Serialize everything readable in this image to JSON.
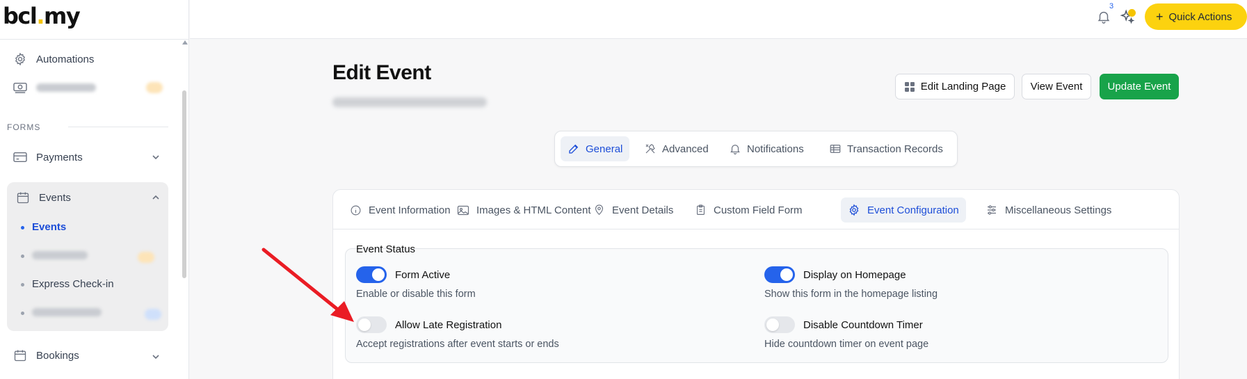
{
  "brand": {
    "logo_pre": "bcl",
    "logo_dot": ".",
    "logo_post": "my"
  },
  "sidebar": {
    "section_forms": "FORMS",
    "automations": "Automations",
    "payments": "Payments",
    "events": "Events",
    "events_sub": [
      "Events",
      "Express Check-in"
    ],
    "bookings": "Bookings"
  },
  "topbar": {
    "notification_count": "3",
    "quick_actions": "Quick Actions"
  },
  "header": {
    "title": "Edit Event",
    "edit_landing": "Edit Landing Page",
    "view_event": "View Event",
    "update_event": "Update Event"
  },
  "top_tabs": [
    "General",
    "Advanced",
    "Notifications",
    "Transaction Records"
  ],
  "card_tabs": [
    "Event Information",
    "Images & HTML Content",
    "Event Details",
    "Custom Field Form",
    "Event Configuration",
    "Miscellaneous Settings"
  ],
  "event_status": {
    "title": "Event Status",
    "options": [
      {
        "label": "Form Active",
        "desc": "Enable or disable this form",
        "on": true
      },
      {
        "label": "Display on Homepage",
        "desc": "Show this form in the homepage listing",
        "on": true
      },
      {
        "label": "Allow Late Registration",
        "desc": "Accept registrations after event starts or ends",
        "on": false
      },
      {
        "label": "Disable Countdown Timer",
        "desc": "Hide countdown timer on event page",
        "on": false
      }
    ]
  },
  "colors": {
    "primary": "#2563eb",
    "update_green": "#18a34a",
    "quick_yellow": "#fcd20f",
    "arrow_red": "#ea1c24"
  }
}
